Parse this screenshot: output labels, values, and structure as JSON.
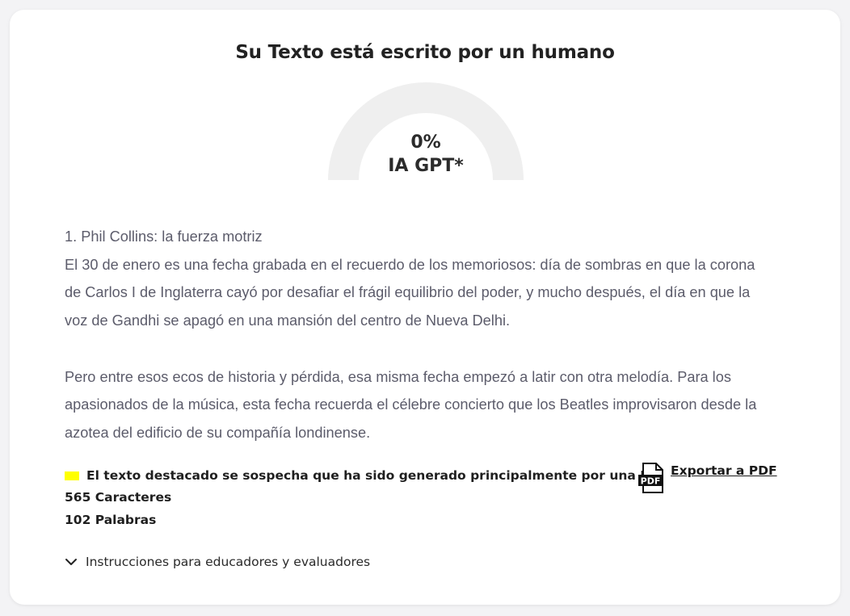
{
  "result": {
    "title": "Su Texto está escrito por un humano",
    "ai_fraction": 0.0,
    "percent_label": "0%",
    "gauge_label": "IA GPT*"
  },
  "analyzed_text": {
    "paragraph_1": [
      "1. Phil Collins: la fuerza motriz",
      "El 30 de enero es una fecha grabada en el recuerdo de los memoriosos: día de sombras en que la corona",
      "de Carlos I de Inglaterra cayó por desafiar el frágil equilibrio del poder, y mucho después, el día en que la",
      "voz de Gandhi se apagó en una mansión del centro de Nueva Delhi."
    ],
    "paragraph_2": [
      "Pero entre esos ecos de historia y pérdida, esa misma fecha empezó a latir con otra melodía. Para los",
      "apasionados de la música, esta fecha recuerda el célebre concierto que los Beatles improvisaron desde la",
      "azotea del edificio de su compañía londinense."
    ]
  },
  "legend": {
    "highlight_text": "El texto destacado se sospecha que ha sido generado principalmente por una IA*",
    "highlight_color": "#ffff00"
  },
  "stats": {
    "characters": "565 Caracteres",
    "words": "102 Palabras"
  },
  "export": {
    "label": "Exportar a PDF",
    "icon_text": "PDF",
    "icon": "pdf-file-icon"
  },
  "instructions": {
    "label": "Instrucciones para educadores y evaluadores",
    "icon": "chevron-down-icon"
  },
  "colors": {
    "gauge_track": "#efefef",
    "gauge_fill": "#e74c3c",
    "body_text": "#5c5c6b"
  }
}
